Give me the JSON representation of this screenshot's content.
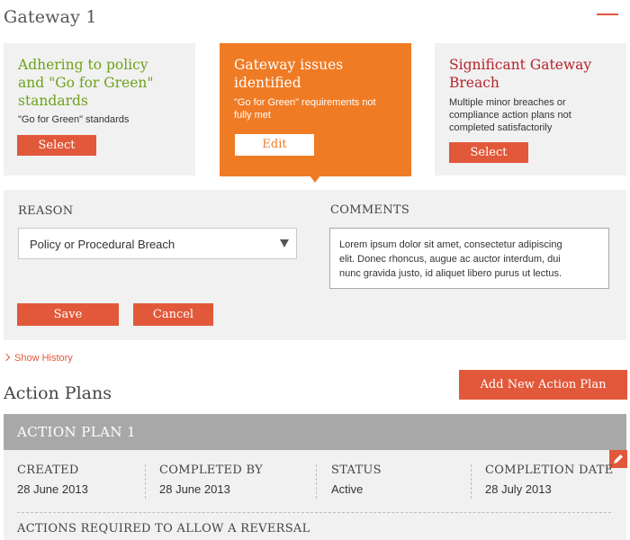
{
  "page": {
    "title": "Gateway 1"
  },
  "options": [
    {
      "title_lines": [
        "Adhering to policy",
        "and \"Go for Green\"",
        "standards"
      ],
      "description": "\"Go for Green\" standards",
      "button": "Select",
      "color": "#6ea21b"
    },
    {
      "title_lines": [
        "Gateway issues",
        "identified"
      ],
      "description_lines": [
        "\"Go for Green\" requirements not",
        "fully met"
      ],
      "button": "Edit",
      "color": "#ef7b25",
      "selected": true
    },
    {
      "title_lines": [
        "Significant Gateway",
        "Breach"
      ],
      "description_lines": [
        "Multiple minor breaches or",
        "compliance action plans not",
        "completed satisfactorily"
      ],
      "button": "Select",
      "color": "#b5232c"
    }
  ],
  "form": {
    "reason_label": "REASON",
    "reason_value": "Policy or Procedural Breach",
    "comments_label": "COMMENTS",
    "comments_lines": [
      "Lorem ipsum dolor sit amet, consectetur adipiscing",
      "elit. Donec rhoncus, augue ac auctor interdum, dui",
      "nunc gravida justo, id aliquet libero purus ut lectus."
    ],
    "save": "Save",
    "cancel": "Cancel"
  },
  "history_link": "Show History",
  "action_plans": {
    "title": "Action Plans",
    "add_button": "Add New Action Plan",
    "plan": {
      "title": "ACTION PLAN 1",
      "columns": [
        {
          "label": "CREATED",
          "value": "28 June 2013"
        },
        {
          "label": "COMPLETED BY",
          "value": "28 June 2013"
        },
        {
          "label": "STATUS",
          "value": "Active"
        },
        {
          "label": "COMPLETION DATE",
          "value": "28 July 2013"
        }
      ],
      "actions_title": "ACTIONS REQUIRED TO ALLOW A REVERSAL"
    }
  },
  "icons": {
    "collapse": "minus-icon",
    "edit": "pencil-icon",
    "history": "chevron-right-icon",
    "dropdown": "caret-down-icon"
  },
  "accent_color": "#e2583a"
}
